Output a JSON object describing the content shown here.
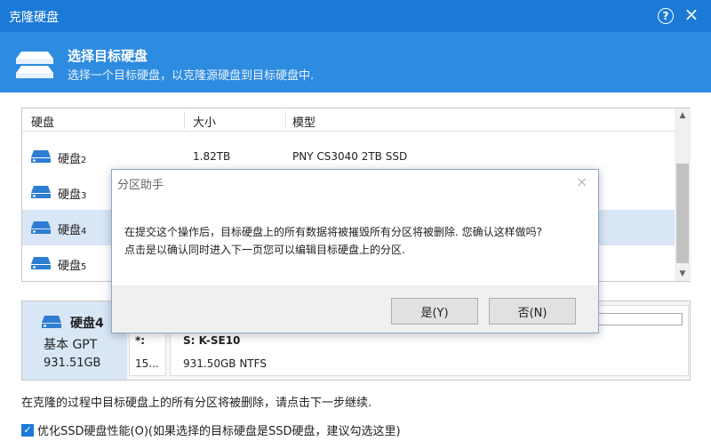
{
  "window": {
    "title": "克隆硬盘",
    "help_glyph": "?",
    "close_glyph": "×"
  },
  "header": {
    "title": "选择目标硬盘",
    "subtitle": "选择一个目标硬盘，以克隆源硬盘到目标硬盘中."
  },
  "table": {
    "columns": [
      "硬盘",
      "大小",
      "模型"
    ],
    "rows": [
      {
        "name": "硬盘",
        "index": "2",
        "size": "1.82TB",
        "model": "PNY CS3040 2TB SSD"
      },
      {
        "name": "硬盘",
        "index": "3",
        "size": "",
        "model": ""
      },
      {
        "name": "硬盘",
        "index": "4",
        "size": "",
        "model": ""
      },
      {
        "name": "硬盘",
        "index": "5",
        "size": "",
        "model": ""
      }
    ]
  },
  "disk_panel": {
    "name": "硬盘4",
    "type": "基本 GPT",
    "capacity": "931.51GB",
    "part1": {
      "label": "*:",
      "size": "15..."
    },
    "part2": {
      "label": "S: K-SE10",
      "size": "931.50GB NTFS"
    }
  },
  "note": "在克隆的过程中目标硬盘上的所有分区将被删除，请点击下一步继续.",
  "option": {
    "checked_glyph": "✓",
    "label": "优化SSD硬盘性能(O)(如果选择的目标硬盘是SSD硬盘，建议勾选这里)"
  },
  "dialog": {
    "title": "分区助手",
    "close_glyph": "×",
    "message_line1": "在提交这个操作后，目标硬盘上的所有数据将被摧毁所有分区将被删除. 您确认这样做吗?",
    "message_line2": "点击是以确认同时进入下一页您可以编辑目标硬盘上的分区.",
    "yes_label": "是(Y)",
    "no_label": "否(N)"
  },
  "colors": {
    "titlebar": "#1c7ad7",
    "header": "#2e8ce0",
    "selection": "#d9e6f6"
  },
  "icons": {
    "disk": "disk-drive-icon",
    "header": "disks-icon"
  }
}
